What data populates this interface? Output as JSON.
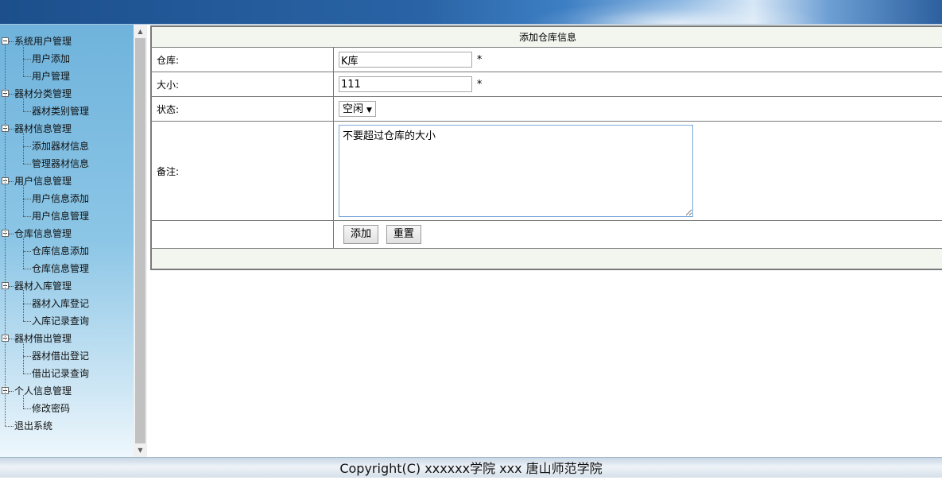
{
  "sidebar": {
    "groups": [
      {
        "label": "系统用户管理",
        "items": [
          "用户添加",
          "用户管理"
        ]
      },
      {
        "label": "器材分类管理",
        "items": [
          "器材类别管理"
        ]
      },
      {
        "label": "器材信息管理",
        "items": [
          "添加器材信息",
          "管理器材信息"
        ]
      },
      {
        "label": "用户信息管理",
        "items": [
          "用户信息添加",
          "用户信息管理"
        ]
      },
      {
        "label": "仓库信息管理",
        "items": [
          "仓库信息添加",
          "仓库信息管理"
        ]
      },
      {
        "label": "器材入库管理",
        "items": [
          "器材入库登记",
          "入库记录查询"
        ]
      },
      {
        "label": "器材借出管理",
        "items": [
          "器材借出登记",
          "借出记录查询"
        ]
      },
      {
        "label": "个人信息管理",
        "items": [
          "修改密码"
        ]
      }
    ],
    "exit_label": "退出系统"
  },
  "form": {
    "title": "添加仓库信息",
    "warehouse_label": "仓库:",
    "warehouse_value": "K库",
    "size_label": "大小:",
    "size_value": "111",
    "required_mark": "*",
    "status_label": "状态:",
    "status_value": "空闲",
    "note_label": "备注:",
    "note_value": "不要超过仓库的大小",
    "submit_label": "添加",
    "reset_label": "重置"
  },
  "footer": {
    "copyright": "Copyright(C) xxxxxx学院 xxx 唐山师范学院"
  }
}
